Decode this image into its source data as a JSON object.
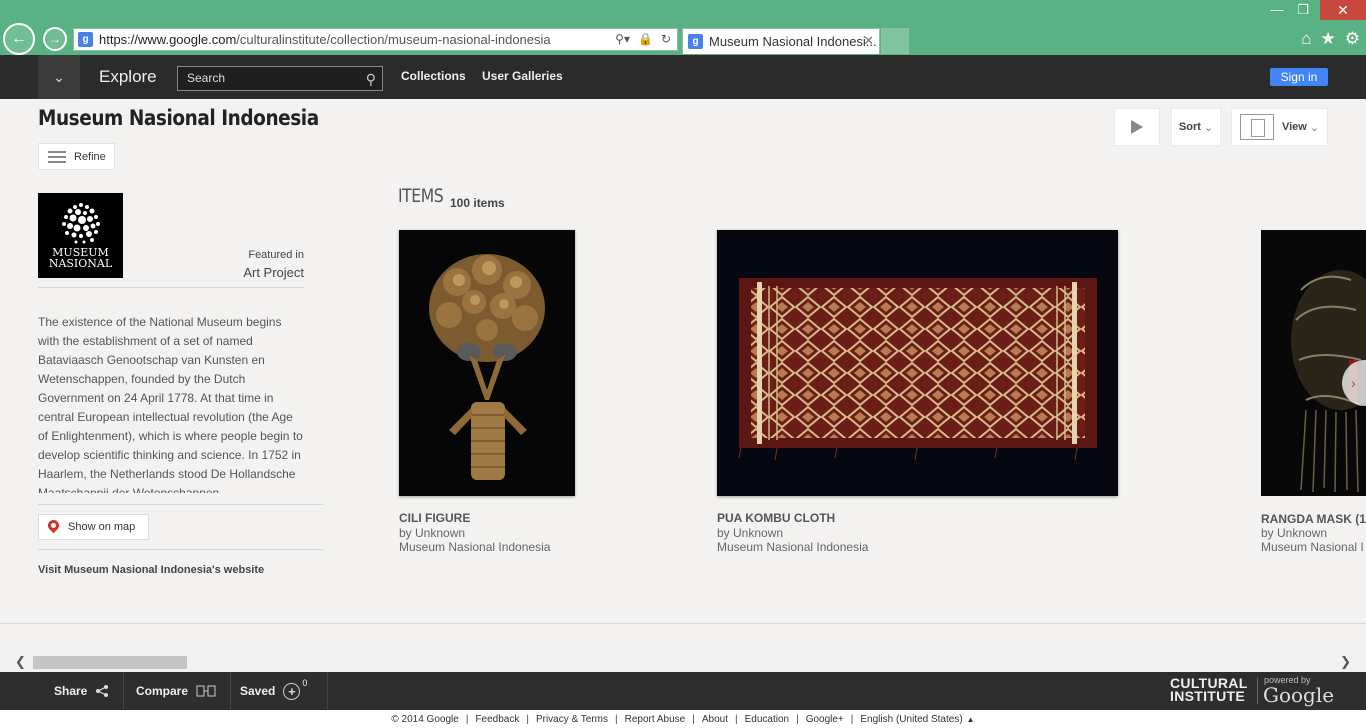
{
  "browser": {
    "url_prefix": "https://www.google.com",
    "url_path": "/culturalinstitute/collection/museum-nasional-indonesia",
    "tab_title": "Museum Nasional Indonesi...",
    "favicon_letter": "g",
    "accent_color": "#59b283"
  },
  "header": {
    "explore_label": "Explore",
    "search_placeholder": "Search",
    "nav_links": [
      "Collections",
      "User Galleries"
    ],
    "signin_label": "Sign in"
  },
  "page": {
    "title": "Museum Nasional Indonesia",
    "refine_label": "Refine",
    "sort_label": "Sort",
    "view_label": "View"
  },
  "collection": {
    "logo_line1": "MUSEUM",
    "logo_line2": "NASIONAL",
    "featured_in": "Featured in",
    "featured_name": "Art Project",
    "description": "The existence of the National Museum begins with the establishment of a set of named Bataviaasch Genootschap van Kunsten en Wetenschappen, founded by the Dutch Government on 24 April 1778. At that time in central European intellectual revolution (the Age of Enlightenment), which is where people begin to develop scientific thinking and science. In 1752 in Haarlem, the Netherlands stood De Hollandsche Maatschappij der Wetenschappen",
    "map_label": "Show on map",
    "visit_label": "Visit Museum Nasional Indonesia's website"
  },
  "items": {
    "label": "ITEMS",
    "count": "100 items",
    "list": [
      {
        "title": "CILI FIGURE",
        "creator": "by Unknown",
        "museum": "Museum Nasional Indonesia"
      },
      {
        "title": "PUA KOMBU CLOTH",
        "creator": "by Unknown",
        "museum": "Museum Nasional Indonesia"
      },
      {
        "title": "RANGDA MASK (1",
        "creator": "by Unknown",
        "museum": "Museum Nasional I"
      }
    ]
  },
  "footer": {
    "share_label": "Share",
    "compare_label": "Compare",
    "saved_label": "Saved",
    "saved_count": "0",
    "ci_line1": "CULTURAL",
    "ci_line2": "INSTITUTE",
    "powered_by": "powered by",
    "google_word": "Google",
    "links": [
      "© 2014 Google",
      "Feedback",
      "Privacy & Terms",
      "Report Abuse",
      "About",
      "Education",
      "Google+",
      "English (United States)"
    ]
  }
}
